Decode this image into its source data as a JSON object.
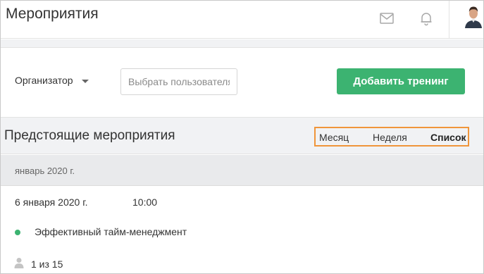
{
  "header": {
    "title": "Мероприятия",
    "icons": [
      "mail-icon",
      "bell-icon",
      "avatar"
    ]
  },
  "filters": {
    "organizer_label": "Организатор",
    "user_placeholder": "Выбрать пользователя",
    "add_button_label": "Добавить тренинг"
  },
  "section": {
    "title": "Предстоящие мероприятия",
    "views": {
      "month": "Месяц",
      "week": "Неделя",
      "list": "Список",
      "active": "list"
    }
  },
  "events": {
    "month_label": "январь 2020 г.",
    "items": [
      {
        "date": "6 января 2020 г.",
        "time": "10:00",
        "name": "Эффективный тайм-менеджмент",
        "status_color": "#3cb371",
        "seats": "1 из 15"
      }
    ]
  },
  "colors": {
    "accent": "#3cb371",
    "highlight": "#f0953a"
  }
}
